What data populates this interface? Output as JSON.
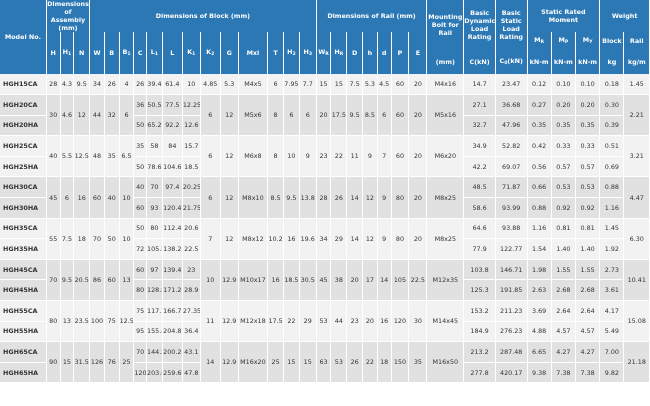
{
  "headers": {
    "model_no": "Model No.",
    "assembly": "Dimensions of Assembly (mm)",
    "block": "Dimensions of Block (mm)",
    "rail": "Dimensions of Rail (mm)",
    "mounting": "Mounting Bolt for Rail",
    "dynamic": "Basic Dynamic Load Rating",
    "static_load": "Basic Static Load Rating",
    "moment": "Static Rated Moment",
    "weight": "Weight",
    "weight_block": "Block",
    "weight_rail": "Rail",
    "units": {
      "mounting": "(mm)",
      "c": "C(kN)",
      "c0": "C0(kN)",
      "mr": "kN-m",
      "mp": "kN-m",
      "my": "kN-m",
      "block": "kg",
      "rail": "kg/m"
    }
  },
  "groups": [
    {
      "rows": [
        [
          "HGH15CA",
          "28",
          "4.3",
          "9.5",
          "34",
          "26",
          "4",
          "26",
          "39.4",
          "61.4",
          "10",
          "4.85",
          "5.3",
          "M4x5",
          "6",
          "7.95",
          "7.7",
          "15",
          "15",
          "7.5",
          "5.3",
          "4.5",
          "60",
          "20",
          "M4x16",
          "14.7",
          "23.47",
          "0.12",
          "0.10",
          "0.10",
          "0.18",
          "1.45"
        ]
      ]
    },
    {
      "rows": [
        [
          "HGH20CA",
          "30",
          "4.6",
          "12",
          "44",
          "32",
          "6",
          "36",
          "50.5",
          "77.5",
          "12.25",
          "6",
          "12",
          "M5x6",
          "8",
          "6",
          "6",
          "20",
          "17.5",
          "9.5",
          "8.5",
          "6",
          "60",
          "20",
          "M5x16",
          "27.1",
          "36.68",
          "0.27",
          "0.20",
          "0.20",
          "0.30",
          "2.21"
        ],
        [
          "HGH20HA",
          "",
          "",
          "",
          "",
          "",
          "",
          "50",
          "65.2",
          "92.2",
          "12.6",
          "",
          "",
          "",
          "",
          "",
          "",
          "",
          "",
          "",
          "",
          "",
          "",
          "",
          "",
          "32.7",
          "47.96",
          "0.35",
          "0.35",
          "0.35",
          "0.39",
          ""
        ]
      ]
    },
    {
      "rows": [
        [
          "HGH25CA",
          "40",
          "5.5",
          "12.5",
          "48",
          "35",
          "6.5",
          "35",
          "58",
          "84",
          "15.7",
          "6",
          "12",
          "M6x8",
          "8",
          "10",
          "9",
          "23",
          "22",
          "11",
          "9",
          "7",
          "60",
          "20",
          "M6x20",
          "34.9",
          "52.82",
          "0.42",
          "0.33",
          "0.33",
          "0.51",
          "3.21"
        ],
        [
          "HGH25HA",
          "",
          "",
          "",
          "",
          "",
          "",
          "50",
          "78.6",
          "104.6",
          "18.5",
          "",
          "",
          "",
          "",
          "",
          "",
          "",
          "",
          "",
          "",
          "",
          "",
          "",
          "",
          "42.2",
          "69.07",
          "0.56",
          "0.57",
          "0.57",
          "0.69",
          ""
        ]
      ]
    },
    {
      "rows": [
        [
          "HGH30CA",
          "45",
          "6",
          "16",
          "60",
          "40",
          "10",
          "40",
          "70",
          "97.4",
          "20.25",
          "6",
          "12",
          "M8x10",
          "8.5",
          "9.5",
          "13.8",
          "28",
          "26",
          "14",
          "12",
          "9",
          "80",
          "20",
          "M8x25",
          "48.5",
          "71.87",
          "0.66",
          "0.53",
          "0.53",
          "0.88",
          "4.47"
        ],
        [
          "HGH30HA",
          "",
          "",
          "",
          "",
          "",
          "",
          "60",
          "93",
          "120.4",
          "21.75",
          "",
          "",
          "",
          "",
          "",
          "",
          "",
          "",
          "",
          "",
          "",
          "",
          "",
          "",
          "58.6",
          "93.99",
          "0.88",
          "0.92",
          "0.92",
          "1.16",
          ""
        ]
      ]
    },
    {
      "rows": [
        [
          "HGH35CA",
          "55",
          "7.5",
          "18",
          "70",
          "50",
          "10",
          "50",
          "80",
          "112.4",
          "20.6",
          "7",
          "12",
          "M8x12",
          "10.2",
          "16",
          "19.6",
          "34",
          "29",
          "14",
          "12",
          "9",
          "80",
          "20",
          "M8x25",
          "64.6",
          "93.88",
          "1.16",
          "0.81",
          "0.81",
          "1.45",
          "6.30"
        ],
        [
          "HGH35HA",
          "",
          "",
          "",
          "",
          "",
          "",
          "72",
          "105.8",
          "138.2",
          "22.5",
          "",
          "",
          "",
          "",
          "",
          "",
          "",
          "",
          "",
          "",
          "",
          "",
          "",
          "",
          "77.9",
          "122.77",
          "1.54",
          "1.40",
          "1.40",
          "1.92",
          ""
        ]
      ]
    },
    {
      "rows": [
        [
          "HGH45CA",
          "70",
          "9.5",
          "20.5",
          "86",
          "60",
          "13",
          "60",
          "97",
          "139.4",
          "23",
          "10",
          "12.9",
          "M10x17",
          "16",
          "18.5",
          "30.5",
          "45",
          "38",
          "20",
          "17",
          "14",
          "105",
          "22.5",
          "M12x35",
          "103.8",
          "146.71",
          "1.98",
          "1.55",
          "1.55",
          "2.73",
          "10.41"
        ],
        [
          "HGH45HA",
          "",
          "",
          "",
          "",
          "",
          "",
          "80",
          "128.8",
          "171.2",
          "28.9",
          "",
          "",
          "",
          "",
          "",
          "",
          "",
          "",
          "",
          "",
          "",
          "",
          "",
          "",
          "125.3",
          "191.85",
          "2.63",
          "2.68",
          "2.68",
          "3.61",
          ""
        ]
      ]
    },
    {
      "rows": [
        [
          "HGH55CA",
          "80",
          "13",
          "23.5",
          "100",
          "75",
          "12.5",
          "75",
          "117.7",
          "166.7",
          "27.35",
          "11",
          "12.9",
          "M12x18",
          "17.5",
          "22",
          "29",
          "53",
          "44",
          "23",
          "20",
          "16",
          "120",
          "30",
          "M14x45",
          "153.2",
          "211.23",
          "3.69",
          "2.64",
          "2.64",
          "4.17",
          "15.08"
        ],
        [
          "HGH55HA",
          "",
          "",
          "",
          "",
          "",
          "",
          "95",
          "155.8",
          "204.8",
          "36.4",
          "",
          "",
          "",
          "",
          "",
          "",
          "",
          "",
          "",
          "",
          "",
          "",
          "",
          "",
          "184.9",
          "276.23",
          "4.88",
          "4.57",
          "4.57",
          "5.49",
          ""
        ]
      ]
    },
    {
      "rows": [
        [
          "HGH65CA",
          "90",
          "15",
          "31.5",
          "126",
          "76",
          "25",
          "70",
          "144.2",
          "200.2",
          "43.1",
          "14",
          "12.9",
          "M16x20",
          "25",
          "15",
          "15",
          "63",
          "53",
          "26",
          "22",
          "18",
          "150",
          "35",
          "M16x50",
          "213.2",
          "287.48",
          "6.65",
          "4.27",
          "4.27",
          "7.00",
          "21.18"
        ],
        [
          "HGH65HA",
          "",
          "",
          "",
          "",
          "",
          "",
          "120",
          "203.6",
          "259.6",
          "47.8",
          "",
          "",
          "",
          "",
          "",
          "",
          "",
          "",
          "",
          "",
          "",
          "",
          "",
          "",
          "277.8",
          "420.17",
          "9.38",
          "7.38",
          "7.38",
          "9.82",
          ""
        ]
      ]
    }
  ]
}
